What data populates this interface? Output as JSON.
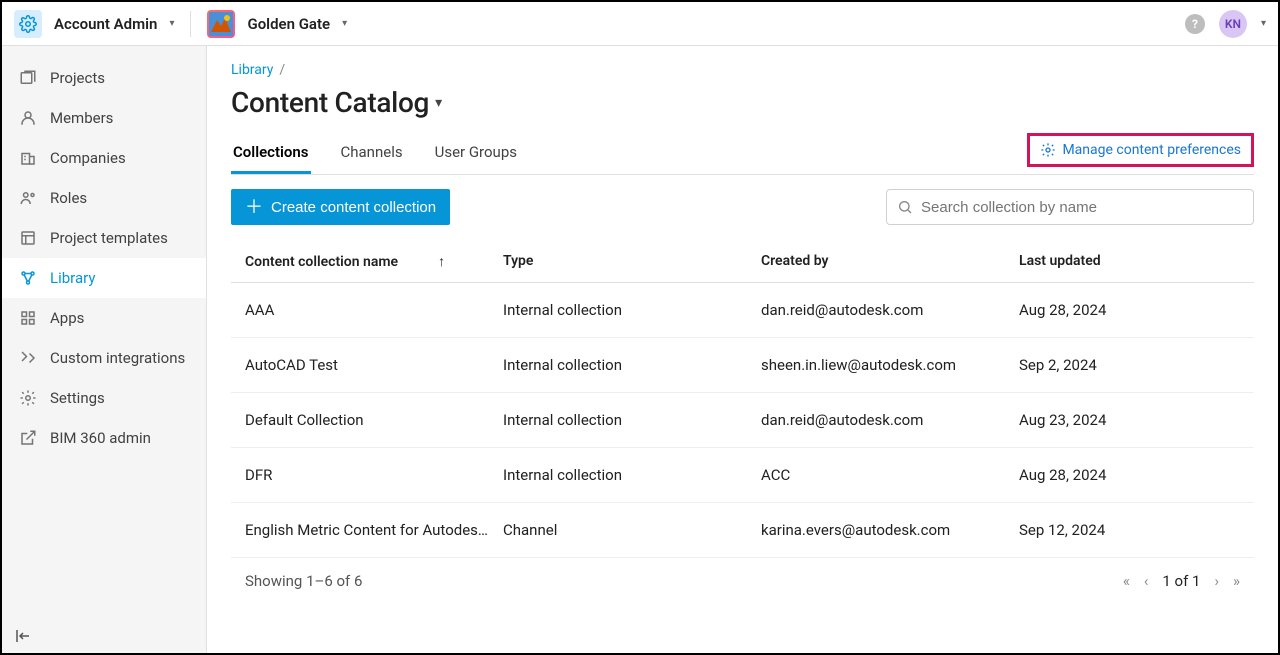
{
  "header": {
    "account_label": "Account Admin",
    "project_label": "Golden Gate",
    "avatar_initials": "KN",
    "help_label": "?"
  },
  "sidebar": {
    "items": [
      {
        "label": "Projects"
      },
      {
        "label": "Members"
      },
      {
        "label": "Companies"
      },
      {
        "label": "Roles"
      },
      {
        "label": "Project templates"
      },
      {
        "label": "Library"
      },
      {
        "label": "Apps"
      },
      {
        "label": "Custom integrations"
      },
      {
        "label": "Settings"
      },
      {
        "label": "BIM 360 admin"
      }
    ]
  },
  "breadcrumb": {
    "root": "Library"
  },
  "page": {
    "title": "Content Catalog"
  },
  "tabs": [
    {
      "label": "Collections"
    },
    {
      "label": "Channels"
    },
    {
      "label": "User Groups"
    }
  ],
  "preferences_link": "Manage content preferences",
  "create_button": "Create content collection",
  "search": {
    "placeholder": "Search collection by name"
  },
  "table": {
    "columns": {
      "name": "Content collection name",
      "type": "Type",
      "created_by": "Created by",
      "last_updated": "Last updated"
    },
    "rows": [
      {
        "name": "AAA",
        "type": "Internal collection",
        "created_by": "dan.reid@autodesk.com",
        "last_updated": "Aug 28, 2024"
      },
      {
        "name": "AutoCAD Test",
        "type": "Internal collection",
        "created_by": "sheen.in.liew@autodesk.com",
        "last_updated": "Sep 2, 2024"
      },
      {
        "name": "Default Collection",
        "type": "Internal collection",
        "created_by": "dan.reid@autodesk.com",
        "last_updated": "Aug 23, 2024"
      },
      {
        "name": "DFR",
        "type": "Internal collection",
        "created_by": "ACC",
        "last_updated": "Aug 28, 2024"
      },
      {
        "name": "English Metric Content for Autodes…",
        "type": "Channel",
        "created_by": "karina.evers@autodesk.com",
        "last_updated": "Sep 12, 2024"
      }
    ],
    "footer_showing": "Showing 1–6 of 6",
    "page_label": "1 of 1"
  }
}
